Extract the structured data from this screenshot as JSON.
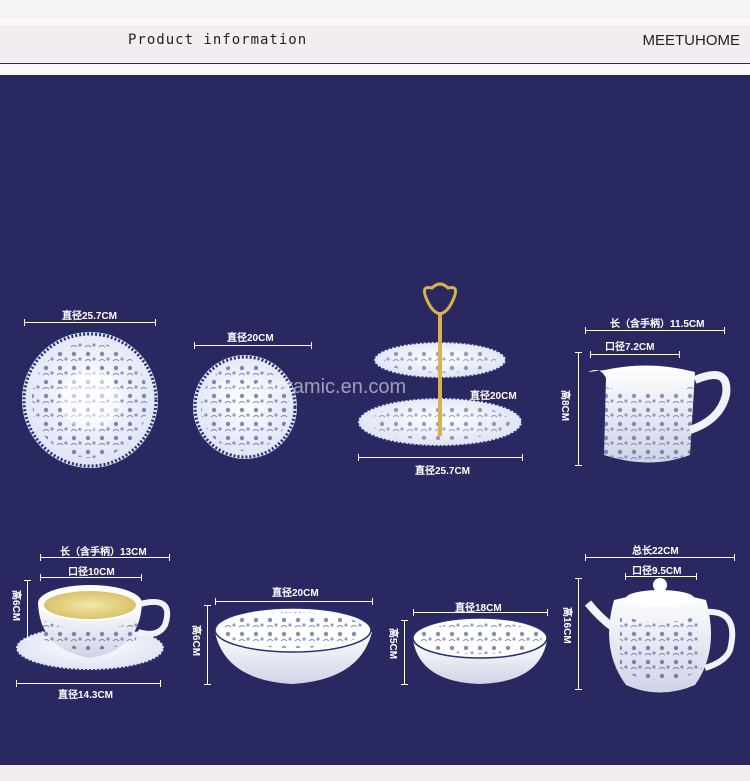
{
  "header": {
    "title": "Product information",
    "brand": "MEETUHOME"
  },
  "watermark": "gracepcramic.en.com",
  "items": {
    "large_plate": {
      "diameter": "直径25.7CM"
    },
    "small_plate": {
      "diameter": "直径20CM"
    },
    "cake_stand": {
      "top": "直径20CM",
      "bottom": "直径25.7CM"
    },
    "creamer": {
      "length": "长（含手柄）11.5CM",
      "mouth": "口径7.2CM",
      "height": "高8CM"
    },
    "cup_saucer": {
      "length": "长（含手柄）13CM",
      "mouth": "口径10CM",
      "height": "高6CM",
      "saucer": "直径14.3CM"
    },
    "large_bowl": {
      "diameter": "直径20CM",
      "height": "高6CM"
    },
    "small_bowl": {
      "diameter": "直径18CM",
      "height": "高5CM"
    },
    "teapot": {
      "length": "总长22CM",
      "mouth": "口径9.5CM",
      "height": "高16CM"
    }
  }
}
